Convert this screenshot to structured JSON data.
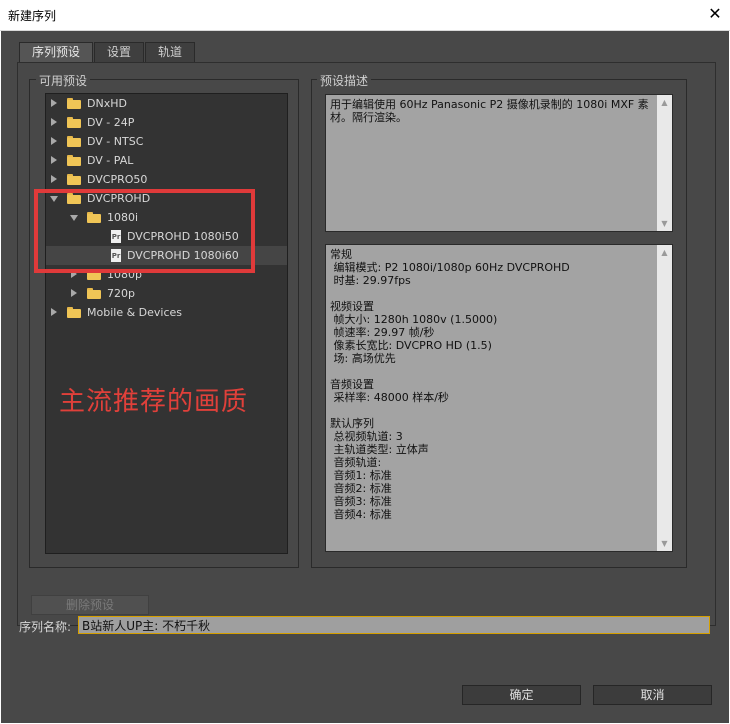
{
  "window": {
    "title": "新建序列",
    "close_glyph": "✕"
  },
  "tabs": [
    {
      "label": "序列预设",
      "active": true
    },
    {
      "label": "设置",
      "active": false
    },
    {
      "label": "轨道",
      "active": false
    }
  ],
  "presets": {
    "group_label": "可用预设",
    "tree": [
      {
        "label": "DNxHD",
        "expanded": false
      },
      {
        "label": "DV - 24P",
        "expanded": false
      },
      {
        "label": "DV - NTSC",
        "expanded": false
      },
      {
        "label": "DV - PAL",
        "expanded": false
      },
      {
        "label": "DVCPRO50",
        "expanded": false
      },
      {
        "label": "DVCPROHD",
        "expanded": true
      },
      {
        "label": "1080i",
        "expanded": true
      },
      {
        "label": "DVCPROHD 1080i50"
      },
      {
        "label": "DVCPROHD 1080i60",
        "selected": true
      },
      {
        "label": "1080p",
        "expanded": false
      },
      {
        "label": "720p",
        "expanded": false
      },
      {
        "label": "Mobile & Devices",
        "expanded": false
      }
    ],
    "file_icon_text": "Pr",
    "annotation": "主流推荐的画质",
    "delete_button": "删除预设"
  },
  "description": {
    "group_label": "预设描述",
    "summary": "用于编辑使用 60Hz Panasonic P2 摄像机录制的 1080i MXF 素材。隔行渲染。",
    "details": "常规\n 编辑模式: P2 1080i/1080p 60Hz DVCPROHD\n 时基: 29.97fps\n\n视频设置\n 帧大小: 1280h 1080v (1.5000)\n 帧速率: 29.97 帧/秒\n 像素长宽比: DVCPRO HD (1.5)\n 场: 高场优先\n\n音频设置\n 采样率: 48000 样本/秒\n\n默认序列\n 总视频轨道: 3\n 主轨道类型: 立体声\n 音频轨道:\n 音频1: 标准\n 音频2: 标准\n 音频3: 标准\n 音频4: 标准"
  },
  "sequence_name": {
    "label": "序列名称:",
    "value": "B站新人UP主: 不朽千秋"
  },
  "buttons": {
    "ok": "确定",
    "cancel": "取消"
  },
  "colors": {
    "annotation_red": "#e03a3a",
    "panel_bg": "#484848",
    "folder": "#f0c556"
  }
}
